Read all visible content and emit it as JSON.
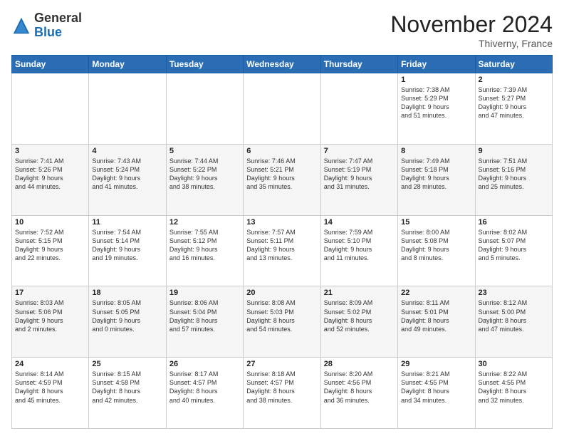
{
  "logo": {
    "general": "General",
    "blue": "Blue"
  },
  "title": "November 2024",
  "location": "Thiverny, France",
  "days_header": [
    "Sunday",
    "Monday",
    "Tuesday",
    "Wednesday",
    "Thursday",
    "Friday",
    "Saturday"
  ],
  "weeks": [
    [
      {
        "day": "",
        "info": ""
      },
      {
        "day": "",
        "info": ""
      },
      {
        "day": "",
        "info": ""
      },
      {
        "day": "",
        "info": ""
      },
      {
        "day": "",
        "info": ""
      },
      {
        "day": "1",
        "info": "Sunrise: 7:38 AM\nSunset: 5:29 PM\nDaylight: 9 hours\nand 51 minutes."
      },
      {
        "day": "2",
        "info": "Sunrise: 7:39 AM\nSunset: 5:27 PM\nDaylight: 9 hours\nand 47 minutes."
      }
    ],
    [
      {
        "day": "3",
        "info": "Sunrise: 7:41 AM\nSunset: 5:26 PM\nDaylight: 9 hours\nand 44 minutes."
      },
      {
        "day": "4",
        "info": "Sunrise: 7:43 AM\nSunset: 5:24 PM\nDaylight: 9 hours\nand 41 minutes."
      },
      {
        "day": "5",
        "info": "Sunrise: 7:44 AM\nSunset: 5:22 PM\nDaylight: 9 hours\nand 38 minutes."
      },
      {
        "day": "6",
        "info": "Sunrise: 7:46 AM\nSunset: 5:21 PM\nDaylight: 9 hours\nand 35 minutes."
      },
      {
        "day": "7",
        "info": "Sunrise: 7:47 AM\nSunset: 5:19 PM\nDaylight: 9 hours\nand 31 minutes."
      },
      {
        "day": "8",
        "info": "Sunrise: 7:49 AM\nSunset: 5:18 PM\nDaylight: 9 hours\nand 28 minutes."
      },
      {
        "day": "9",
        "info": "Sunrise: 7:51 AM\nSunset: 5:16 PM\nDaylight: 9 hours\nand 25 minutes."
      }
    ],
    [
      {
        "day": "10",
        "info": "Sunrise: 7:52 AM\nSunset: 5:15 PM\nDaylight: 9 hours\nand 22 minutes."
      },
      {
        "day": "11",
        "info": "Sunrise: 7:54 AM\nSunset: 5:14 PM\nDaylight: 9 hours\nand 19 minutes."
      },
      {
        "day": "12",
        "info": "Sunrise: 7:55 AM\nSunset: 5:12 PM\nDaylight: 9 hours\nand 16 minutes."
      },
      {
        "day": "13",
        "info": "Sunrise: 7:57 AM\nSunset: 5:11 PM\nDaylight: 9 hours\nand 13 minutes."
      },
      {
        "day": "14",
        "info": "Sunrise: 7:59 AM\nSunset: 5:10 PM\nDaylight: 9 hours\nand 11 minutes."
      },
      {
        "day": "15",
        "info": "Sunrise: 8:00 AM\nSunset: 5:08 PM\nDaylight: 9 hours\nand 8 minutes."
      },
      {
        "day": "16",
        "info": "Sunrise: 8:02 AM\nSunset: 5:07 PM\nDaylight: 9 hours\nand 5 minutes."
      }
    ],
    [
      {
        "day": "17",
        "info": "Sunrise: 8:03 AM\nSunset: 5:06 PM\nDaylight: 9 hours\nand 2 minutes."
      },
      {
        "day": "18",
        "info": "Sunrise: 8:05 AM\nSunset: 5:05 PM\nDaylight: 9 hours\nand 0 minutes."
      },
      {
        "day": "19",
        "info": "Sunrise: 8:06 AM\nSunset: 5:04 PM\nDaylight: 8 hours\nand 57 minutes."
      },
      {
        "day": "20",
        "info": "Sunrise: 8:08 AM\nSunset: 5:03 PM\nDaylight: 8 hours\nand 54 minutes."
      },
      {
        "day": "21",
        "info": "Sunrise: 8:09 AM\nSunset: 5:02 PM\nDaylight: 8 hours\nand 52 minutes."
      },
      {
        "day": "22",
        "info": "Sunrise: 8:11 AM\nSunset: 5:01 PM\nDaylight: 8 hours\nand 49 minutes."
      },
      {
        "day": "23",
        "info": "Sunrise: 8:12 AM\nSunset: 5:00 PM\nDaylight: 8 hours\nand 47 minutes."
      }
    ],
    [
      {
        "day": "24",
        "info": "Sunrise: 8:14 AM\nSunset: 4:59 PM\nDaylight: 8 hours\nand 45 minutes."
      },
      {
        "day": "25",
        "info": "Sunrise: 8:15 AM\nSunset: 4:58 PM\nDaylight: 8 hours\nand 42 minutes."
      },
      {
        "day": "26",
        "info": "Sunrise: 8:17 AM\nSunset: 4:57 PM\nDaylight: 8 hours\nand 40 minutes."
      },
      {
        "day": "27",
        "info": "Sunrise: 8:18 AM\nSunset: 4:57 PM\nDaylight: 8 hours\nand 38 minutes."
      },
      {
        "day": "28",
        "info": "Sunrise: 8:20 AM\nSunset: 4:56 PM\nDaylight: 8 hours\nand 36 minutes."
      },
      {
        "day": "29",
        "info": "Sunrise: 8:21 AM\nSunset: 4:55 PM\nDaylight: 8 hours\nand 34 minutes."
      },
      {
        "day": "30",
        "info": "Sunrise: 8:22 AM\nSunset: 4:55 PM\nDaylight: 8 hours\nand 32 minutes."
      }
    ]
  ]
}
